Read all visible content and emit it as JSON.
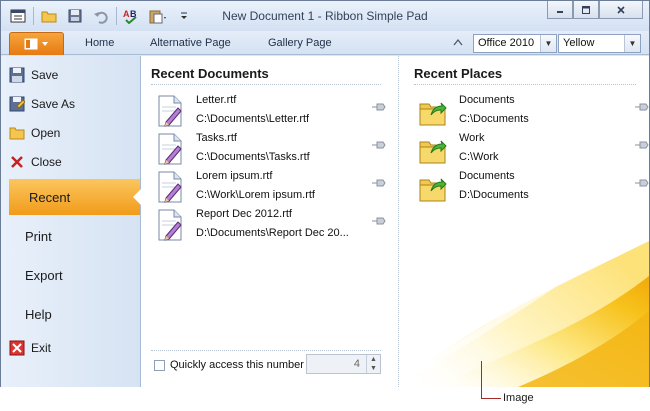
{
  "window": {
    "title": "New Document 1 - Ribbon Simple Pad",
    "controls": {
      "minimize": "minimize-icon",
      "maximize": "maximize-icon",
      "close": "close-icon"
    }
  },
  "quick_access": [
    "app-icon",
    "open-folder-icon",
    "save-icon",
    "undo-icon",
    "spell-check-icon",
    "paste-icon",
    "customize-dropdown-icon"
  ],
  "tabs": [
    {
      "label": "Home"
    },
    {
      "label": "Alternative Page"
    },
    {
      "label": "Gallery Page"
    }
  ],
  "theme_combo": {
    "value": "Office 2010"
  },
  "color_combo": {
    "value": "Yellow"
  },
  "backstage": {
    "commands_top": [
      {
        "label": "Save",
        "icon": "save-icon"
      },
      {
        "label": "Save As",
        "icon": "save-as-icon"
      },
      {
        "label": "Open",
        "icon": "open-folder-icon"
      },
      {
        "label": "Close",
        "icon": "close-x-icon"
      }
    ],
    "tabs": [
      {
        "label": "Recent",
        "selected": true
      },
      {
        "label": "Print"
      },
      {
        "label": "Export"
      },
      {
        "label": "Help"
      }
    ],
    "exit": {
      "label": "Exit",
      "icon": "exit-icon"
    },
    "recent_documents": {
      "heading": "Recent Documents",
      "items": [
        {
          "name": "Letter.rtf",
          "path": "C:\\Documents\\Letter.rtf"
        },
        {
          "name": "Tasks.rtf",
          "path": "C:\\Documents\\Tasks.rtf"
        },
        {
          "name": "Lorem ipsum.rtf",
          "path": "C:\\Work\\Lorem ipsum.rtf"
        },
        {
          "name": "Report Dec 2012.rtf",
          "path": "D:\\Documents\\Report Dec 20..."
        }
      ],
      "quick_access": {
        "label": "Quickly access this number o",
        "value": "4",
        "checked": false
      }
    },
    "recent_places": {
      "heading": "Recent Places",
      "items": [
        {
          "name": "Documents",
          "path": "C:\\Documents"
        },
        {
          "name": "Work",
          "path": "C:\\Work"
        },
        {
          "name": "Documents",
          "path": "D:\\Documents"
        }
      ]
    }
  },
  "annotation": {
    "label": "Image"
  },
  "colors": {
    "accent": "#f19b1a",
    "title_bg": "#dbe6f4",
    "text": "#1a1a1a"
  }
}
